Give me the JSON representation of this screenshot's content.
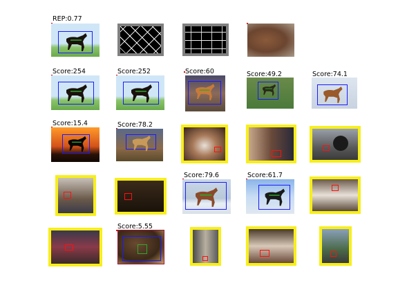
{
  "labels": {
    "rep": "REP:0.77",
    "r1": [
      "Score:254",
      "Score:252",
      "Score:60",
      "Score:49.2",
      "Score:74.1"
    ],
    "r2": [
      "Score:15.4",
      "Score:78.2"
    ],
    "r3": [
      "Score:79.6",
      "Score:61.7"
    ],
    "r4": [
      "Score:5.55"
    ]
  },
  "colors": {
    "highlight": "#f7ef1a",
    "detection": "#1a1aff",
    "false_positive": "#ff1010"
  }
}
